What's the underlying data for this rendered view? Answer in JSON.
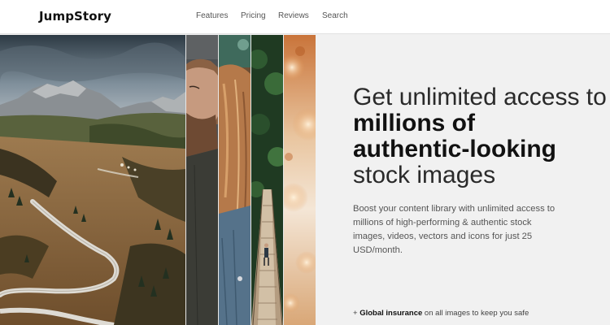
{
  "nav": {
    "logo": "JumpStory",
    "links": [
      "Features",
      "Pricing",
      "Reviews",
      "Search"
    ]
  },
  "hero": {
    "headline": {
      "line1": "Get unlimited access to",
      "line2": "millions of",
      "line3": "authentic-looking",
      "line4": "stock images"
    },
    "subtext": "Boost your content library with unlimited access to millions of high-performing & authentic stock images, videos, vectors and icons for just 25 USD/month.",
    "insurance": {
      "prefix": "+ ",
      "bold": "Global insurance",
      "suffix": " on all images to keep you safe"
    }
  }
}
